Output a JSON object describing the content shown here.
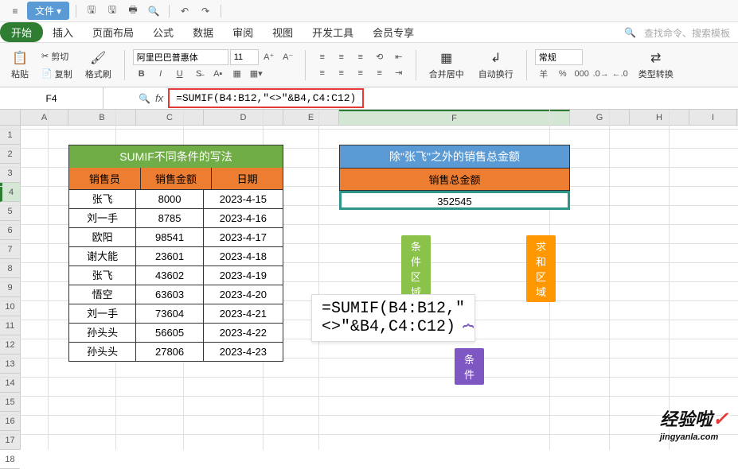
{
  "menubar": {
    "file_label": "文件"
  },
  "tabs": {
    "items": [
      "开始",
      "插入",
      "页面布局",
      "公式",
      "数据",
      "审阅",
      "视图",
      "开发工具",
      "会员专享"
    ],
    "right_label": "查找命令、搜索模板"
  },
  "ribbon": {
    "paste": "粘贴",
    "cut": "剪切",
    "copy": "复制",
    "format_painter": "格式刷",
    "font_name": "阿里巴巴普惠体",
    "font_size": "11",
    "merge": "合并居中",
    "wrap": "自动换行",
    "format_general": "常规",
    "currency": "羊",
    "type_convert": "类型转换"
  },
  "formula_bar": {
    "cell_ref": "F4",
    "fx": "fx",
    "formula": "=SUMIF(B4:B12,\"<>\"&B4,C4:C12)"
  },
  "columns": [
    "A",
    "B",
    "C",
    "D",
    "E",
    "F",
    "G",
    "H",
    "I"
  ],
  "rows": [
    "1",
    "2",
    "3",
    "4",
    "5",
    "6",
    "7",
    "8",
    "9",
    "10",
    "11",
    "12",
    "13",
    "14",
    "15",
    "16",
    "17",
    "18"
  ],
  "table": {
    "title": "SUMIF不同条件的写法",
    "headers": [
      "销售员",
      "销售金额",
      "日期"
    ],
    "rows": [
      [
        "张飞",
        "8000",
        "2023-4-15"
      ],
      [
        "刘一手",
        "8785",
        "2023-4-16"
      ],
      [
        "欧阳",
        "98541",
        "2023-4-17"
      ],
      [
        "谢大能",
        "23601",
        "2023-4-18"
      ],
      [
        "张飞",
        "43602",
        "2023-4-19"
      ],
      [
        "悟空",
        "63603",
        "2023-4-20"
      ],
      [
        "刘一手",
        "73604",
        "2023-4-21"
      ],
      [
        "孙头头",
        "56605",
        "2023-4-22"
      ],
      [
        "孙头头",
        "27806",
        "2023-4-23"
      ]
    ]
  },
  "result": {
    "title": "除\"张飞\"之外的销售总金额",
    "label": "销售总金额",
    "value": "352545"
  },
  "annotations": {
    "range_label": "条件区域",
    "sum_label": "求和区域",
    "criteria_label": "条件",
    "formula_display": "=SUMIF(B4:B12,\"<>\"&B4,C4:C12)"
  },
  "watermark": {
    "top": "经验啦",
    "bot": "jingyanla.com"
  }
}
